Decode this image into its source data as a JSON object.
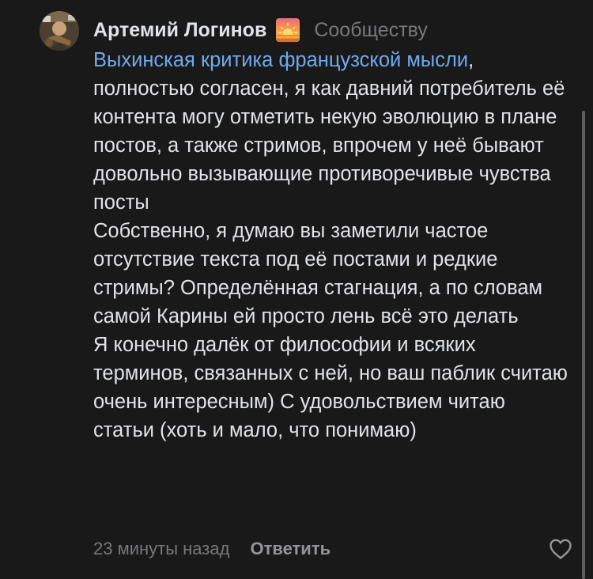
{
  "comment": {
    "author": "Артемий Логинов",
    "author_emoji": "sunset-emoji",
    "context": "Сообществу",
    "mention": "Выхинская критика французской мысли",
    "mention_suffix": ",",
    "paragraphs": [
      "полностью согласен, я как давний потребитель её контента могу отметить некую эволюцию в плане постов, а также стримов, впрочем у неё бывают довольно вызывающие противоречивые чувства посты",
      "Собственно, я думаю вы заметили частое отсутствие текста под её постами и редкие стримы? Определённая стагнация, а по словам самой Карины ей просто лень всё это делать",
      "Я конечно далёк от философии и всяких терминов, связанных с ней, но ваш паблик считаю очень интересным) С удовольствием читаю статьи (хоть и мало, что понимаю)"
    ],
    "timestamp": "23 минуты назад",
    "reply_label": "Ответить",
    "like_icon": "heart-outline-icon"
  },
  "colors": {
    "background": "#19191a",
    "text": "#e1e3e6",
    "secondary": "#76787a",
    "link": "#71aaeb",
    "reply": "#939598"
  }
}
